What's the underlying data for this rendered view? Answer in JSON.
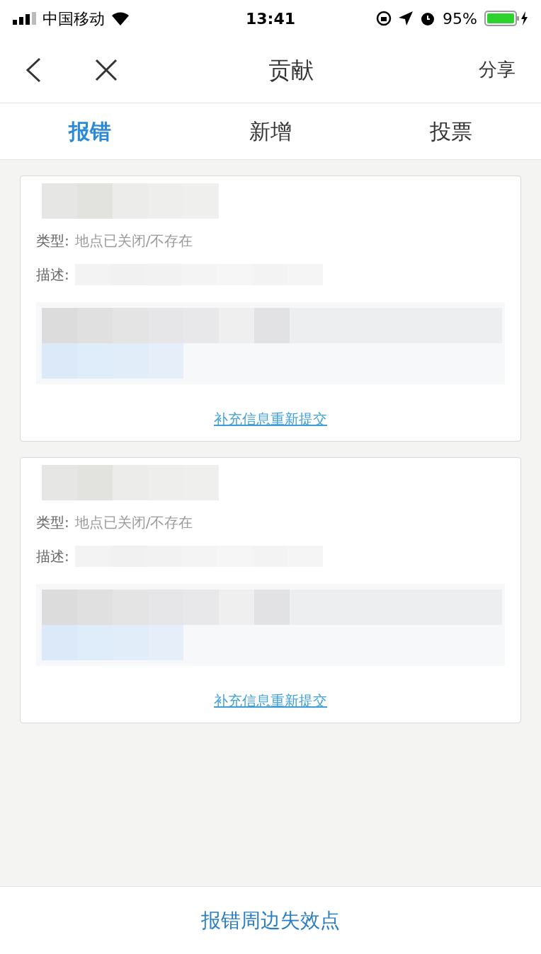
{
  "status_bar": {
    "carrier": "中国移动",
    "time": "13:41",
    "battery": "95%"
  },
  "nav": {
    "title": "贡献",
    "share": "分享"
  },
  "tabs": [
    {
      "label": "报错",
      "selected": true
    },
    {
      "label": "新增",
      "selected": false
    },
    {
      "label": "投票",
      "selected": false
    }
  ],
  "reports": [
    {
      "type_label": "类型:",
      "type_value": "地点已关闭/不存在",
      "desc_label": "描述:",
      "action": "补充信息重新提交"
    },
    {
      "type_label": "类型:",
      "type_value": "地点已关闭/不存在",
      "desc_label": "描述:",
      "action": "补充信息重新提交"
    }
  ],
  "bottom_button": "报错周边失效点"
}
